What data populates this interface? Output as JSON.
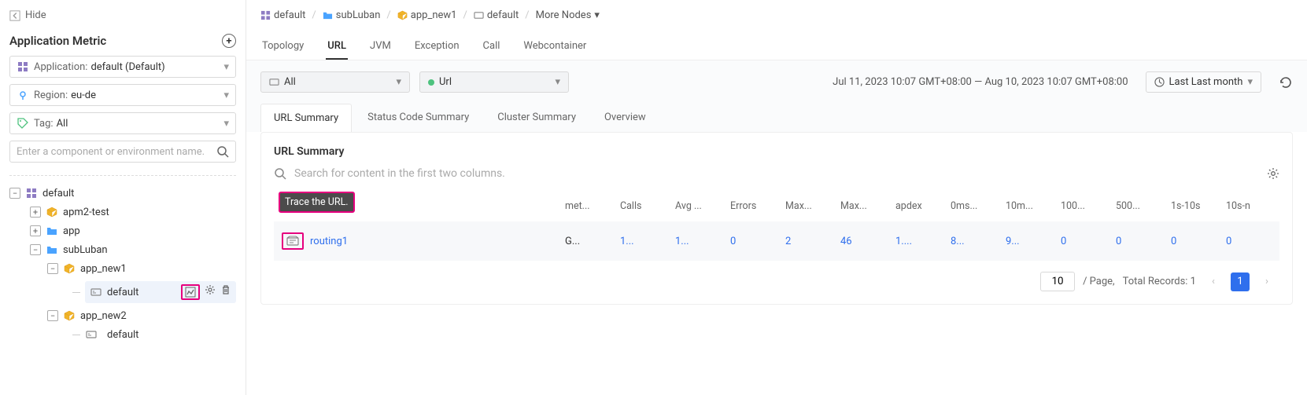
{
  "sidebar": {
    "hide_label": "Hide",
    "title": "Application Metric",
    "application": {
      "label": "Application:",
      "value": "default (Default)"
    },
    "region": {
      "label": "Region:",
      "value": "eu-de"
    },
    "tag": {
      "label": "Tag:",
      "value": "All"
    },
    "search_placeholder": "Enter a component or environment name."
  },
  "tree": {
    "root": "default",
    "n1": "apm2-test",
    "n2": "app",
    "n3": "subLuban",
    "n3a": "app_new1",
    "n3a_env": "default",
    "n3b": "app_new2",
    "n3b_env": "default"
  },
  "breadcrumb": {
    "b1": "default",
    "b2": "subLuban",
    "b3": "app_new1",
    "b4": "default",
    "b5": "More Nodes"
  },
  "tabs": {
    "t1": "Topology",
    "t2": "URL",
    "t3": "JVM",
    "t4": "Exception",
    "t5": "Call",
    "t6": "Webcontainer"
  },
  "filter": {
    "sel1": "All",
    "sel2": "Url",
    "time_range": "Jul 11, 2023 10:07 GMT+08:00 — Aug 10, 2023 10:07 GMT+08:00",
    "picker": "Last Last month"
  },
  "subtabs": {
    "s1": "URL Summary",
    "s2": "Status Code Summary",
    "s3": "Cluster Summary",
    "s4": "Overview"
  },
  "panel": {
    "title": "URL Summary",
    "search_placeholder": "Search for content in the first two columns.",
    "tooltip": "Trace the URL."
  },
  "columns": {
    "c0": "",
    "c1": "met...",
    "c2": "Calls",
    "c3": "Avg ...",
    "c4": "Errors",
    "c5": "Max...",
    "c6": "Max...",
    "c7": "apdex",
    "c8": "0ms...",
    "c9": "10m...",
    "c10": "100...",
    "c11": "500...",
    "c12": "1s-10s",
    "c13": "10s-n"
  },
  "row": {
    "url": "routing1",
    "met": "G...",
    "calls": "1...",
    "avg": "1...",
    "errors": "0",
    "max1": "2",
    "max2": "46",
    "apdex": "1....",
    "b0": "8...",
    "b10": "9...",
    "b100": "0",
    "b500": "0",
    "b1s": "0",
    "b10s": "0"
  },
  "pager": {
    "page_size": "10",
    "per_page_label": "/ Page,",
    "total_label": "Total Records: 1",
    "current": "1"
  }
}
